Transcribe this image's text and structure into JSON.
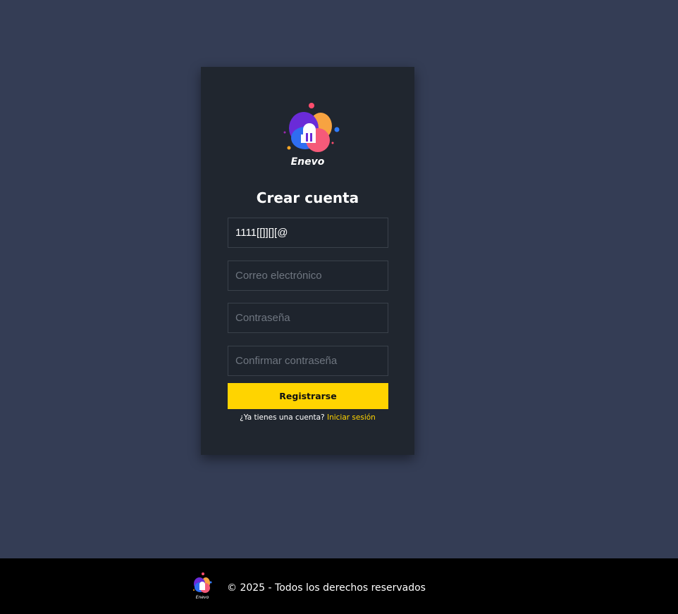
{
  "brand": {
    "name": "Enevo",
    "logo_icon": "enevo-logo-icon"
  },
  "form": {
    "title": "Crear cuenta",
    "username": {
      "value": "1111[[]][][@",
      "placeholder": ""
    },
    "email": {
      "value": "",
      "placeholder": "Correo electrónico"
    },
    "password": {
      "value": "",
      "placeholder": "Contraseña"
    },
    "confirm_password": {
      "value": "",
      "placeholder": "Confirmar contraseña"
    },
    "submit_label": "Registrarse",
    "login_prompt": "¿Ya tienes una cuenta?",
    "login_link": "Iniciar sesión"
  },
  "footer": {
    "text": "© 2025 - Todos los derechos reservados",
    "logo_label": "Enevo"
  },
  "colors": {
    "background": "#343d55",
    "card": "#20262f",
    "accent": "#ffd400",
    "footer": "#000000"
  }
}
